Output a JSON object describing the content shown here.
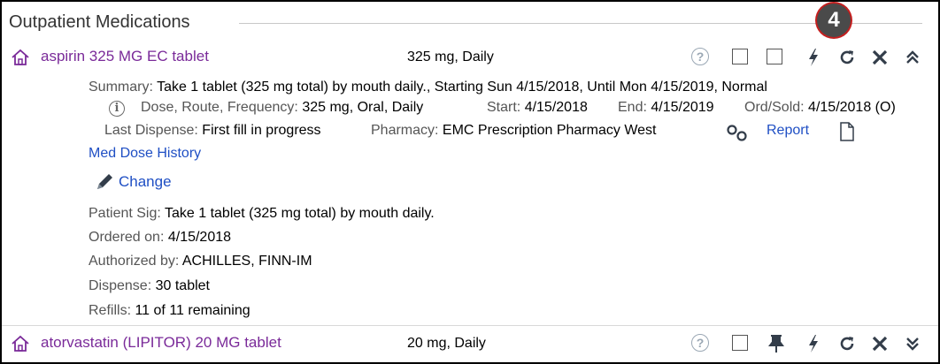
{
  "section": {
    "title": "Outpatient Medications"
  },
  "annotation": {
    "step_number": "4"
  },
  "medications": [
    {
      "name": "aspirin 325 MG EC tablet",
      "dose": "325 mg, Daily",
      "summary_label": "Summary:",
      "summary_value": "Take 1 tablet (325 mg total) by mouth daily., Starting Sun 4/15/2018, Until Mon 4/15/2019, Normal",
      "drf_label": "Dose, Route, Frequency:",
      "drf_value": "325 mg, Oral, Daily",
      "start_label": "Start:",
      "start_value": "4/15/2018",
      "end_label": "End:",
      "end_value": "4/15/2019",
      "ordsold_label": "Ord/Sold:",
      "ordsold_value": "4/15/2018 (O)",
      "last_dispense_label": "Last Dispense:",
      "last_dispense_value": "First fill in progress",
      "pharmacy_label": "Pharmacy:",
      "pharmacy_value": "EMC Prescription Pharmacy West",
      "report_link": "Report",
      "med_dose_history_link": "Med Dose History",
      "change_link": "Change",
      "patient_sig_label": "Patient Sig:",
      "patient_sig_value": "Take 1 tablet (325 mg total) by mouth daily.",
      "ordered_on_label": "Ordered on:",
      "ordered_on_value": "4/15/2018",
      "authorized_by_label": "Authorized by:",
      "authorized_by_value": "ACHILLES, FINN-IM",
      "dispense_label": "Dispense:",
      "dispense_value": "30 tablet",
      "refills_label": "Refills:",
      "refills_value": "11 of 11 remaining"
    },
    {
      "name": "atorvastatin (LIPITOR) 20 MG tablet",
      "dose": "20 mg, Daily"
    }
  ],
  "icons": {
    "help": "?",
    "lightning": "lightning-icon",
    "refresh": "refresh-icon",
    "close": "close-icon",
    "collapse": "collapse-chevron-icon",
    "expand": "expand-chevron-icon",
    "pin": "pin-icon",
    "home": "home-icon",
    "info": "i",
    "pencil": "pencil-icon",
    "link_chain": "link-chain-icon",
    "document": "document-icon"
  },
  "colors": {
    "med_name": "#7a2a99",
    "link": "#1f4fc4",
    "badge": "#4a4a4a",
    "badge_ring": "#c41f1f"
  }
}
